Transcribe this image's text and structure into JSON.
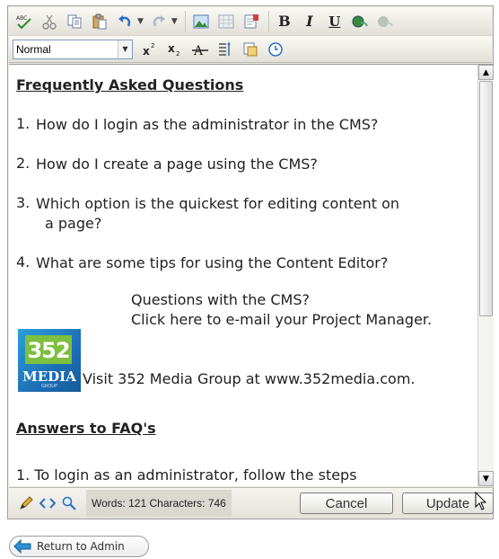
{
  "toolbar": {
    "row1": [
      {
        "name": "spellcheck-icon",
        "glyph": "ABC✔"
      },
      {
        "name": "cut-icon",
        "glyph": "✂"
      },
      {
        "name": "copy-icon",
        "glyph": "⎘"
      },
      {
        "name": "paste-icon",
        "glyph": "📋"
      },
      {
        "name": "undo-icon",
        "glyph": "↶"
      },
      {
        "name": "redo-icon",
        "glyph": "↷"
      },
      {
        "name": "insert-image-icon",
        "glyph": "▣"
      },
      {
        "name": "insert-table-icon",
        "glyph": "▦"
      },
      {
        "name": "insert-media-icon",
        "glyph": "▤"
      },
      {
        "name": "bold-icon",
        "glyph": "B"
      },
      {
        "name": "italic-icon",
        "glyph": "I"
      },
      {
        "name": "underline-icon",
        "glyph": "U"
      },
      {
        "name": "insert-link-icon",
        "glyph": "🔗"
      },
      {
        "name": "remove-link-icon",
        "glyph": "⛓"
      }
    ],
    "format_select": "Normal",
    "row2": [
      {
        "name": "superscript-icon",
        "glyph": "x²"
      },
      {
        "name": "subscript-icon",
        "glyph": "x₂"
      },
      {
        "name": "strikethrough-icon",
        "glyph": "A"
      },
      {
        "name": "paragraph-format-icon",
        "glyph": "¶"
      },
      {
        "name": "template-icon",
        "glyph": "▧"
      },
      {
        "name": "clock-icon",
        "glyph": "🕒"
      }
    ]
  },
  "content": {
    "faq_heading": "Frequently Asked Questions",
    "faq_items": [
      {
        "num": "1.",
        "text": "How do I login as the administrator in the CMS?",
        "cont": ""
      },
      {
        "num": "2.",
        "text": "How do I create a page using the CMS?",
        "cont": ""
      },
      {
        "num": "3.",
        "text": "Which option is the quickest for editing content on",
        "cont": "a page?"
      },
      {
        "num": "4.",
        "text": "What are some tips for using the Content Editor?",
        "cont": ""
      }
    ],
    "promo_line1": "Questions with the CMS?",
    "promo_line2": "Click here to e-mail your Project Manager.",
    "logo_number": "352",
    "logo_word": "MEDIA",
    "logo_sub": "GROUP",
    "visit_text": "Visit 352 Media Group at www.352media.com.",
    "answers_heading": "Answers to FAQ's",
    "answer_partial": "1. To login as an administrator, follow the steps"
  },
  "statusbar": {
    "counts": "Words: 121 Characters: 746",
    "cancel_label": "Cancel",
    "update_label": "Update"
  },
  "footer": {
    "return_label": "Return to Admin"
  },
  "colors": {
    "accent_blue": "#2f8fd3",
    "logo_green": "#7dbf3f",
    "toolbar_bg": "#ecebe6"
  }
}
